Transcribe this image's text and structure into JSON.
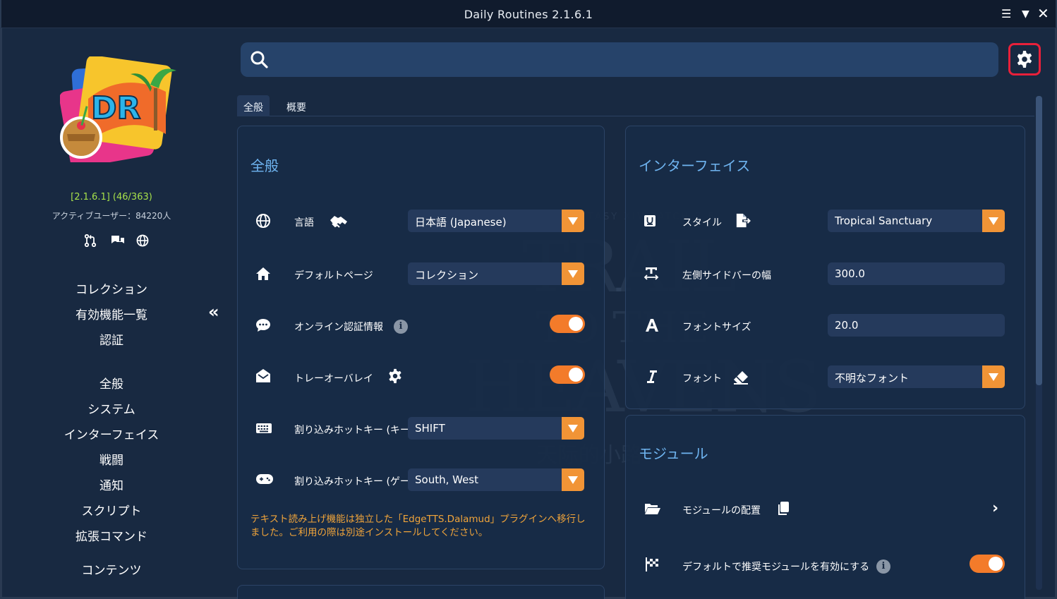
{
  "window": {
    "title": "Daily Routines 2.1.6.1"
  },
  "sidebar": {
    "version": "[2.1.6.1] (46/363)",
    "active_users": "アクティブユーザー：84220人",
    "nav_top": [
      "コレクション",
      "有効機能一覧",
      "認証"
    ],
    "nav_main": [
      "全般",
      "システム",
      "インターフェイス",
      "戦闘",
      "通知",
      "スクリプト",
      "拡張コマンド",
      "コンテンツ"
    ]
  },
  "search": {
    "placeholder": "",
    "value": ""
  },
  "tabs": [
    "全般",
    "概要"
  ],
  "general": {
    "title": "全般",
    "rows": [
      {
        "label": "言語",
        "value": "日本語 (Japanese)"
      },
      {
        "label": "デフォルトページ",
        "value": "コレクション"
      },
      {
        "label": "オンライン認証情報"
      },
      {
        "label": "トレーオーバレイ"
      },
      {
        "label": "割り込みホットキー (キー",
        "value": "SHIFT"
      },
      {
        "label": "割り込みホットキー (ゲー",
        "value": "South, West"
      }
    ],
    "note": "テキスト読み上げ機能は独立した「EdgeTTS.Dalamud」プラグインへ移行しました。ご利用の際は別途インストールしてください。"
  },
  "interface": {
    "title": "インターフェイス",
    "rows": [
      {
        "label": "スタイル",
        "value": "Tropical Sanctuary"
      },
      {
        "label": "左側サイドバーの幅",
        "value": "300.0"
      },
      {
        "label": "フォントサイズ",
        "value": "20.0"
      },
      {
        "label": "フォント",
        "value": "不明なフォント"
      }
    ]
  },
  "module": {
    "title": "モジュール",
    "rows": [
      {
        "label": "モジュールの配置"
      },
      {
        "label": "デフォルトで推奨モジュールを有効にする"
      }
    ]
  },
  "colors": {
    "accent": "#f19436",
    "toggle": "#f37b2a",
    "title": "#6fb4f0",
    "version": "#a6e04a",
    "highlight": "#e8203a"
  }
}
